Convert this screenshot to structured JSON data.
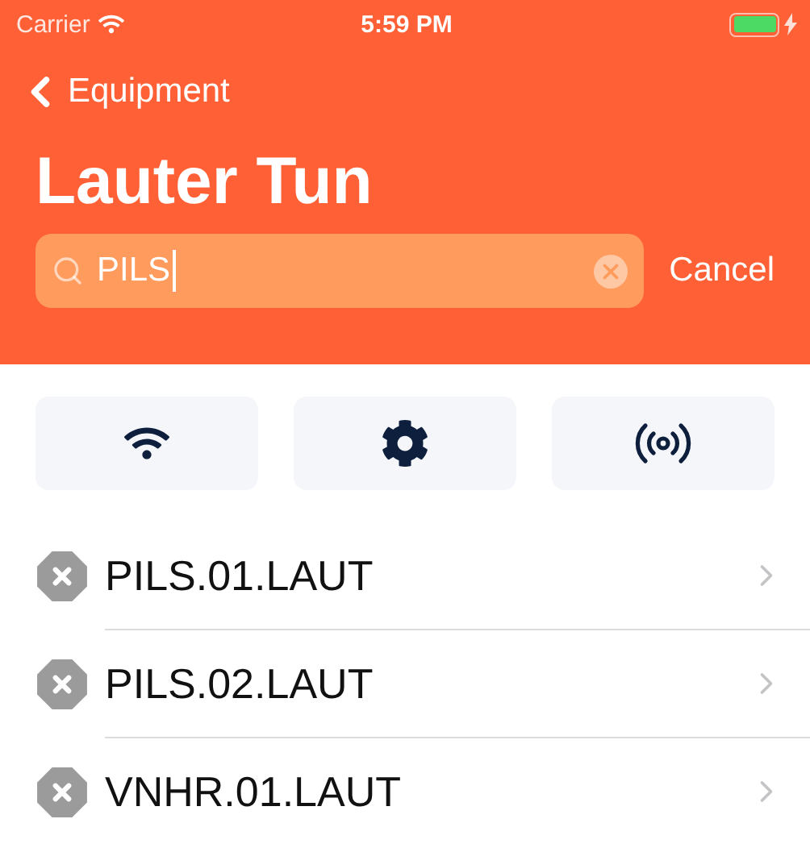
{
  "status_bar": {
    "carrier": "Carrier",
    "time": "5:59 PM"
  },
  "nav": {
    "back_label": "Equipment",
    "title": "Lauter Tun"
  },
  "search": {
    "value": "PILS",
    "cancel_label": "Cancel"
  },
  "actions": [
    {
      "kind": "wifi"
    },
    {
      "kind": "settings"
    },
    {
      "kind": "broadcast"
    }
  ],
  "items": [
    {
      "name": "PILS.01.LAUT"
    },
    {
      "name": "PILS.02.LAUT"
    },
    {
      "name": "VNHR.01.LAUT"
    }
  ]
}
